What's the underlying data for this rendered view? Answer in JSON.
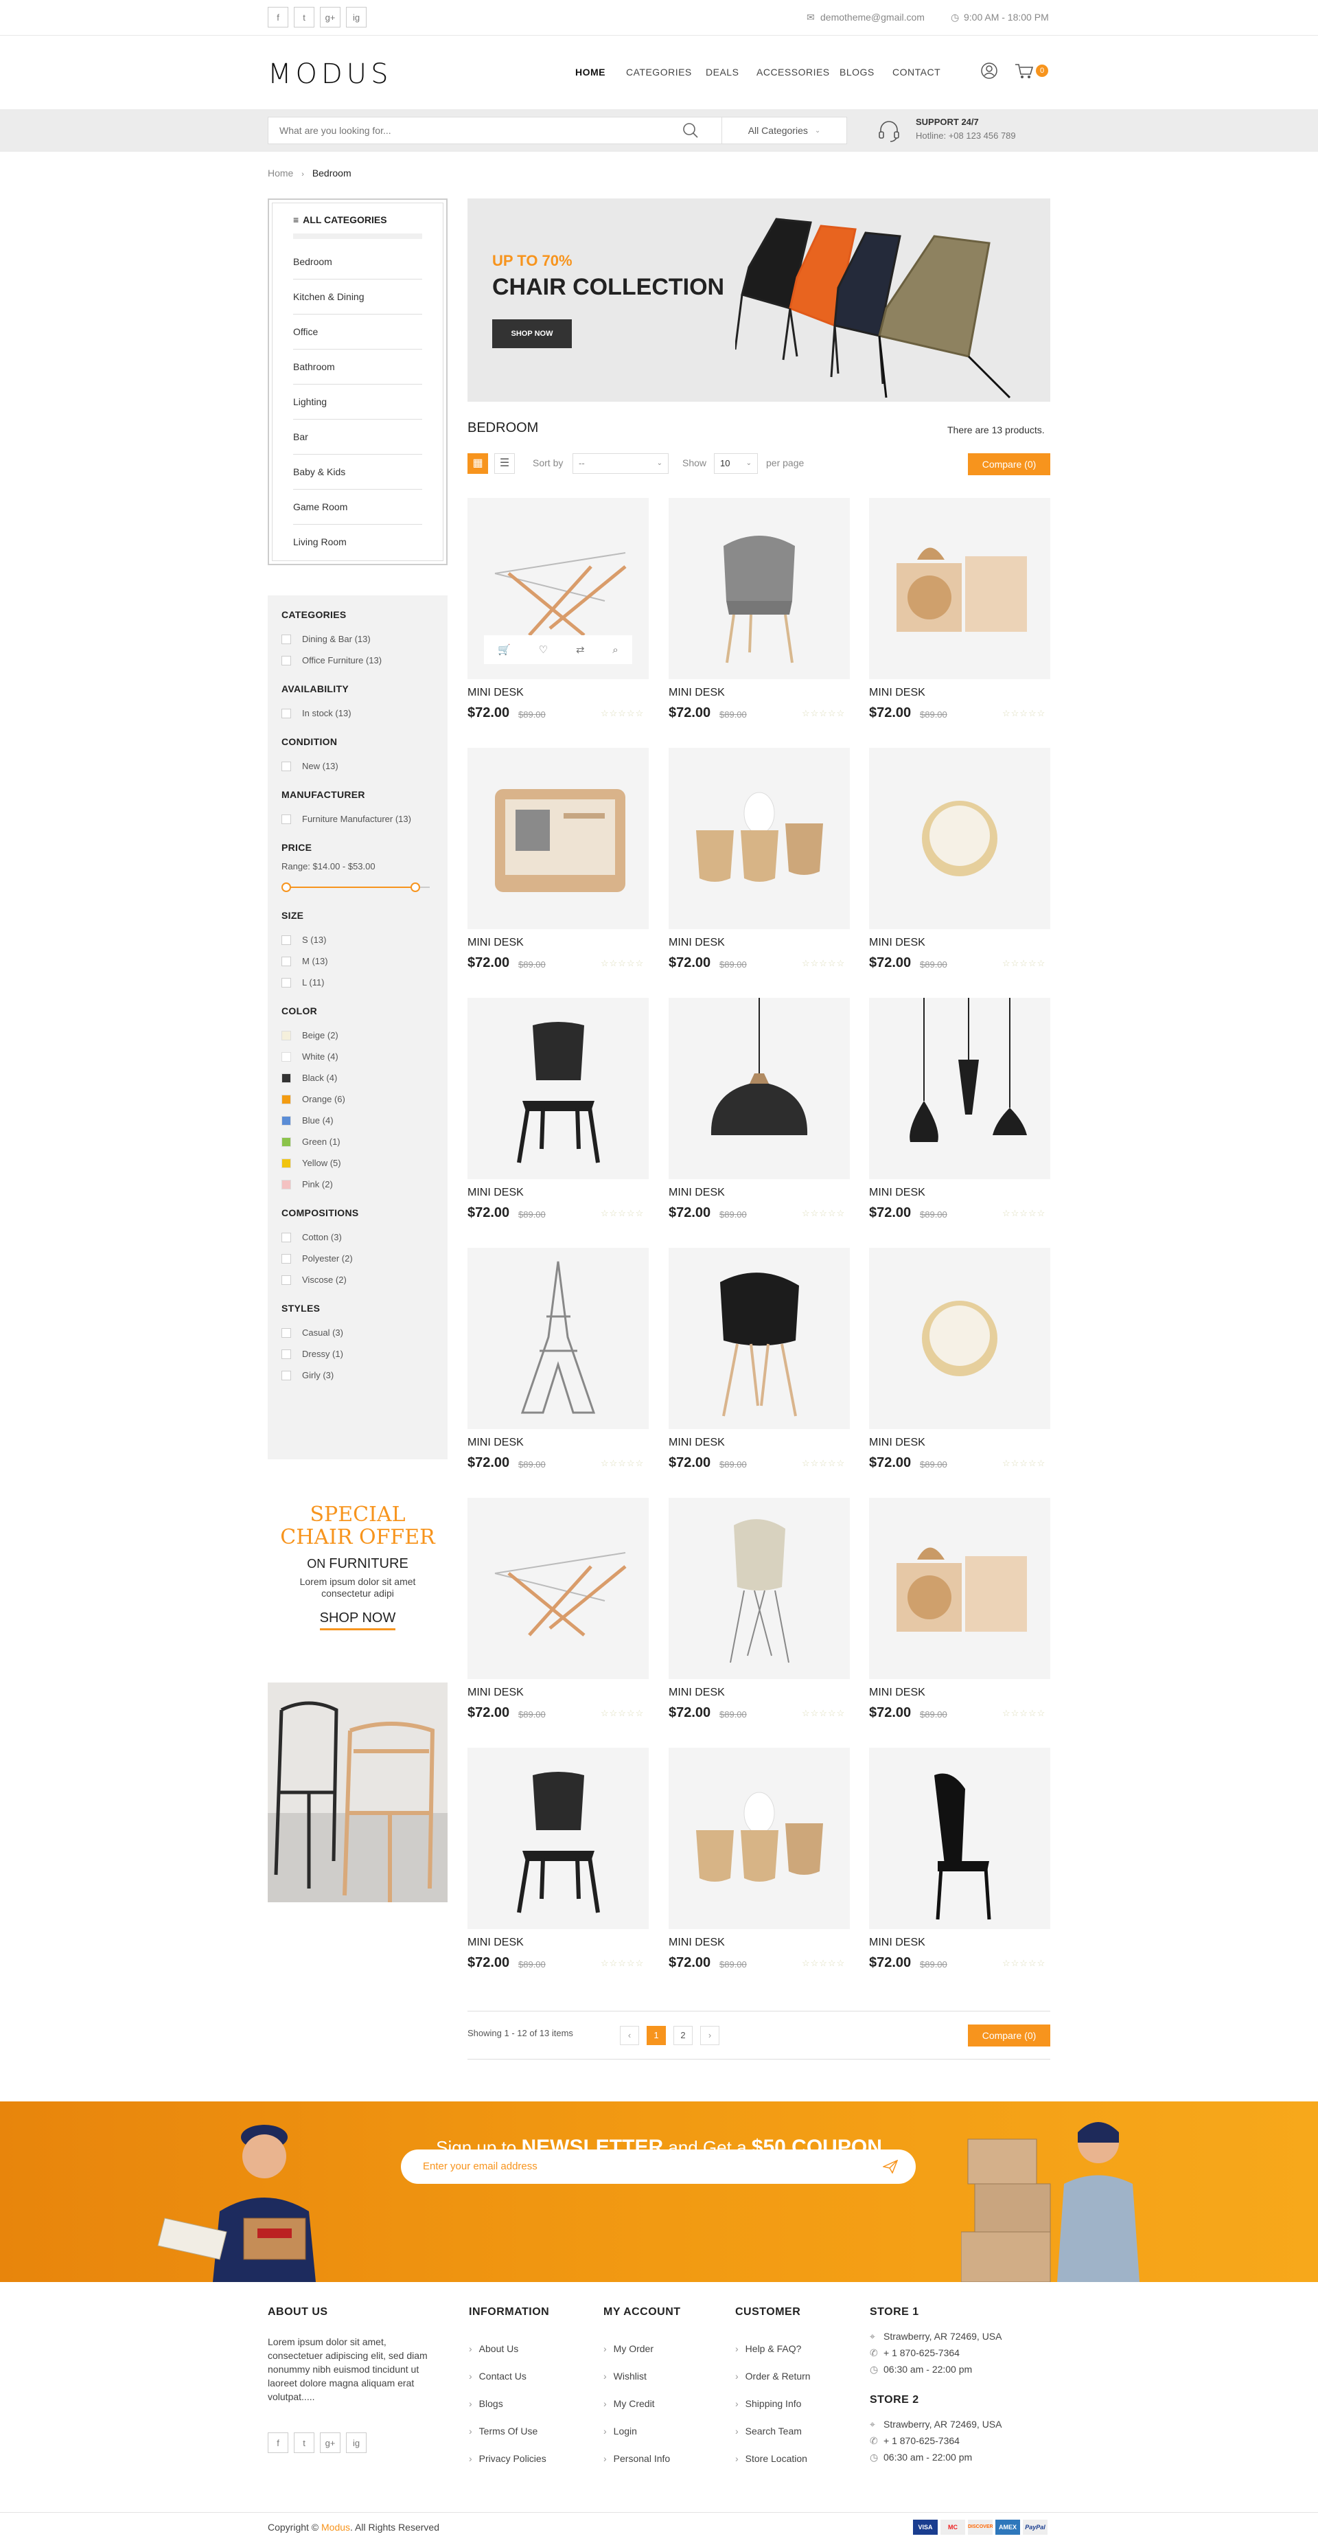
{
  "topbar": {
    "social": [
      "f",
      "t",
      "g+",
      "ig"
    ],
    "email": "demotheme@gmail.com",
    "hours": "9:00 AM - 18:00 PM"
  },
  "header": {
    "logo": "MODUS",
    "nav": [
      "HOME",
      "CATEGORIES",
      "DEALS",
      "ACCESSORIES",
      "BLOGS",
      "CONTACT"
    ],
    "cart_count": "0"
  },
  "search": {
    "placeholder": "What are you looking for...",
    "category": "All Categories",
    "support_title": "SUPPORT 24/7",
    "support_line": "Hotline: +08 123 456 789"
  },
  "breadcrumb": {
    "home": "Home",
    "current": "Bedroom"
  },
  "categories": {
    "title": "ALL CATEGORIES",
    "items": [
      "Bedroom",
      "Kitchen & Dining",
      "Office",
      "Bathroom",
      "Lighting",
      "Bar",
      "Baby & Kids",
      "Game Room",
      "Living Room"
    ]
  },
  "filters": {
    "categories_title": "CATEGORIES",
    "categories": [
      "Dining & Bar (13)",
      "Office Furniture (13)"
    ],
    "availability_title": "AVAILABILITY",
    "availability": [
      "In stock (13)"
    ],
    "condition_title": "CONDITION",
    "condition": [
      "New (13)"
    ],
    "manufacturer_title": "MANUFACTURER",
    "manufacturer": [
      "Furniture Manufacturer (13)"
    ],
    "price_title": "PRICE",
    "price_range": "Range: $14.00 - $53.00",
    "price_range_fill": [
      0.0,
      0.8
    ],
    "size_title": "SIZE",
    "sizes": [
      "S (13)",
      "M (13)",
      "L (11)"
    ],
    "color_title": "COLOR",
    "colors": [
      {
        "label": "Beige (2)",
        "hex": "#f5f0dc"
      },
      {
        "label": "White (4)",
        "hex": "#ffffff"
      },
      {
        "label": "Black (4)",
        "hex": "#333333"
      },
      {
        "label": "Orange (6)",
        "hex": "#f39c12"
      },
      {
        "label": "Blue (4)",
        "hex": "#5b8dd6"
      },
      {
        "label": "Green (1)",
        "hex": "#8bc34a"
      },
      {
        "label": "Yellow (5)",
        "hex": "#f1c40f"
      },
      {
        "label": "Pink (2)",
        "hex": "#f4c2c2"
      }
    ],
    "compositions_title": "COMPOSITIONS",
    "compositions": [
      "Cotton (3)",
      "Polyester (2)",
      "Viscose (2)"
    ],
    "styles_title": "STYLES",
    "styles": [
      "Casual (3)",
      "Dressy (1)",
      "Girly (3)"
    ]
  },
  "offer": {
    "line1": "SPECIAL",
    "line2": "CHAIR OFFER",
    "on": "ON",
    "furniture": "FURNITURE",
    "text": "Lorem ipsum dolor sit amet consectetur adipi",
    "cta": "SHOP NOW"
  },
  "hero": {
    "discount": "UP TO 70%",
    "title": "CHAIR COLLECTION",
    "cta": "SHOP NOW"
  },
  "listing": {
    "title": "BEDROOM",
    "count": "There are 13 products.",
    "sort_label": "Sort by",
    "sort_value": "--",
    "show_label": "Show",
    "show_value": "10",
    "per_page": "per page",
    "compare": "Compare (0)",
    "showing": "Showing 1 - 12 of 13 items",
    "pages": [
      "‹",
      "1",
      "2",
      "›"
    ]
  },
  "products": [
    {
      "name": "MINI DESK",
      "price": "$72.00",
      "old": "$89.00",
      "img": "desk"
    },
    {
      "name": "MINI DESK",
      "price": "$72.00",
      "old": "$89.00",
      "img": "grey-chair"
    },
    {
      "name": "MINI DESK",
      "price": "$72.00",
      "old": "$89.00",
      "img": "wood-box"
    },
    {
      "name": "MINI DESK",
      "price": "$72.00",
      "old": "$89.00",
      "img": "wall-desk"
    },
    {
      "name": "MINI DESK",
      "price": "$72.00",
      "old": "$89.00",
      "img": "egg-cups"
    },
    {
      "name": "MINI DESK",
      "price": "$72.00",
      "old": "$89.00",
      "img": "bowl"
    },
    {
      "name": "MINI DESK",
      "price": "$72.00",
      "old": "$89.00",
      "img": "black-chair"
    },
    {
      "name": "MINI DESK",
      "price": "$72.00",
      "old": "$89.00",
      "img": "pendant-lamp"
    },
    {
      "name": "MINI DESK",
      "price": "$72.00",
      "old": "$89.00",
      "img": "three-lamps"
    },
    {
      "name": "MINI DESK",
      "price": "$72.00",
      "old": "$89.00",
      "img": "eiffel"
    },
    {
      "name": "MINI DESK",
      "price": "$72.00",
      "old": "$89.00",
      "img": "eames-black"
    },
    {
      "name": "MINI DESK",
      "price": "$72.00",
      "old": "$89.00",
      "img": "bowl"
    },
    {
      "name": "MINI DESK",
      "price": "$72.00",
      "old": "$89.00",
      "img": "desk"
    },
    {
      "name": "MINI DESK",
      "price": "$72.00",
      "old": "$89.00",
      "img": "eames-beige"
    },
    {
      "name": "MINI DESK",
      "price": "$72.00",
      "old": "$89.00",
      "img": "wood-box"
    },
    {
      "name": "MINI DESK",
      "price": "$72.00",
      "old": "$89.00",
      "img": "black-chair"
    },
    {
      "name": "MINI DESK",
      "price": "$72.00",
      "old": "$89.00",
      "img": "egg-cups"
    },
    {
      "name": "MINI DESK",
      "price": "$72.00",
      "old": "$89.00",
      "img": "side-chair"
    }
  ],
  "newsletter": {
    "pre": "Sign up to",
    "word": "NEWSLETTER",
    "mid": "and Get a",
    "coupon": "$50 COUPON",
    "placeholder": "Enter your email address"
  },
  "footer": {
    "about_title": "ABOUT US",
    "about_text": "Lorem ipsum dolor sit amet, consectetuer adipiscing elit, sed diam nonummy nibh euismod tincidunt ut laoreet dolore magna aliquam erat volutpat.....",
    "info_title": "INFORMATION",
    "info": [
      "About Us",
      "Contact Us",
      "Blogs",
      "Terms Of Use",
      "Privacy Policies"
    ],
    "account_title": "MY ACCOUNT",
    "account": [
      "My Order",
      "Wishlist",
      "My Credit",
      "Login",
      "Personal Info"
    ],
    "customer_title": "CUSTOMER",
    "customer": [
      "Help & FAQ?",
      "Order & Return",
      "Shipping Info",
      "Search Team",
      "Store Location"
    ],
    "store1_title": "STORE 1",
    "store1": [
      "Strawberry, AR 72469, USA",
      "+ 1 870-625-7364",
      "06:30 am - 22:00 pm"
    ],
    "store2_title": "STORE 2",
    "store2": [
      "Strawberry, AR 72469, USA",
      "+ 1 870-625-7364",
      "06:30 am - 22:00 pm"
    ],
    "copyright_pre": "Copyright ©",
    "copyright_brand": "Modus",
    "copyright_post": ". All Rights Reserved",
    "payments": [
      "VISA",
      "MC",
      "DISCOVER",
      "AMEX",
      "PayPal"
    ]
  }
}
